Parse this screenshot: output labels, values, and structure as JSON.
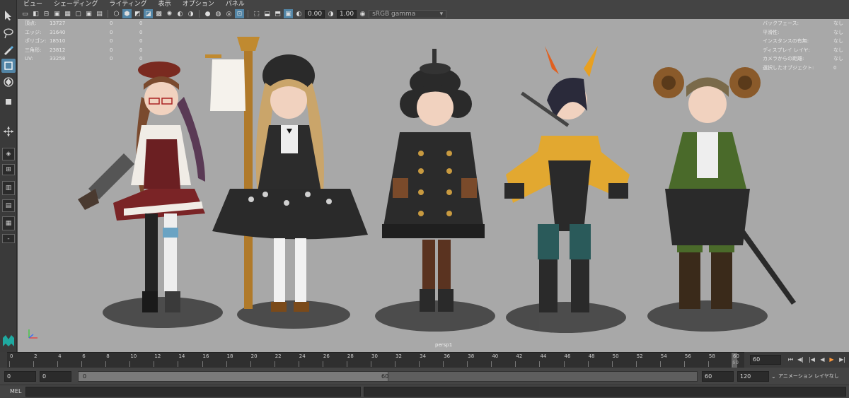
{
  "panel_menu": [
    "ビュー",
    "シェーディング",
    "ライティング",
    "表示",
    "オプション",
    "パネル"
  ],
  "toolbar": {
    "exposure_value": "0.00",
    "gamma_value": "1.00",
    "color_space": "sRGB gamma"
  },
  "hud_left": {
    "rows": [
      {
        "label": "頂点:",
        "v1": "13727",
        "v2": "0",
        "v3": "0"
      },
      {
        "label": "エッジ:",
        "v1": "31640",
        "v2": "0",
        "v3": "0"
      },
      {
        "label": "ポリゴン:",
        "v1": "18510",
        "v2": "0",
        "v3": "0"
      },
      {
        "label": "三角形:",
        "v1": "23812",
        "v2": "0",
        "v3": "0"
      },
      {
        "label": "UV:",
        "v1": "33258",
        "v2": "0",
        "v3": "0"
      }
    ]
  },
  "hud_right": {
    "rows": [
      {
        "label": "バックフェース:",
        "value": "なし"
      },
      {
        "label": "平滑性:",
        "value": "なし"
      },
      {
        "label": "インスタンスの有無:",
        "value": "なし"
      },
      {
        "label": "ディスプレイ レイヤ:",
        "value": "なし"
      },
      {
        "label": "カメラからの距離:",
        "value": "なし"
      },
      {
        "label": "選択したオブジェクト:",
        "value": "0"
      }
    ]
  },
  "viewport": {
    "camera_label": "persp1",
    "background_color": "#a8a8a8"
  },
  "timeline": {
    "ticks": [
      "0",
      "2",
      "4",
      "6",
      "8",
      "10",
      "12",
      "14",
      "16",
      "18",
      "20",
      "22",
      "24",
      "26",
      "28",
      "30",
      "32",
      "34",
      "36",
      "38",
      "40",
      "42",
      "44",
      "46",
      "48",
      "50",
      "52",
      "54",
      "56",
      "58",
      "60"
    ],
    "current_frame_marker_label": "60",
    "current_frame": "60"
  },
  "range": {
    "start_time": "0",
    "playback_start": "0",
    "range_start_label": "0",
    "range_end_label": "60",
    "playback_end": "60",
    "end_time": "120",
    "anim_layer": "アニメーション レイヤなし"
  },
  "command_line": {
    "label": "MEL"
  },
  "colors": {
    "accent": "#5285a6",
    "play_button": "#ff9a3c"
  }
}
